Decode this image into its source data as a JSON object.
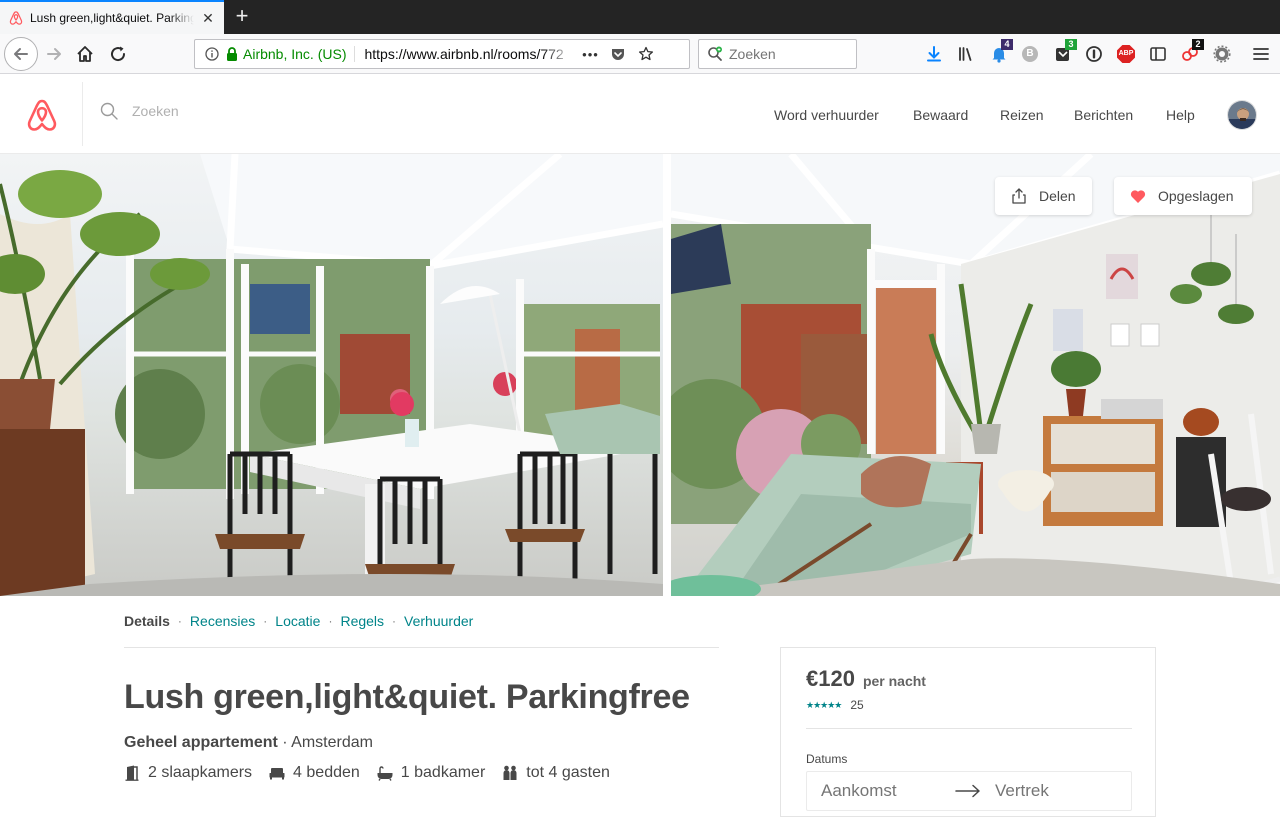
{
  "browser": {
    "tab": {
      "title": "Lush green,light&quiet. Parkingfree"
    },
    "url_identity": "Airbnb, Inc. (US)",
    "url": "https://www.airbnb.nl/rooms/772",
    "search_placeholder": "Zoeken",
    "more_icon": "•••",
    "badges": {
      "notifications": "4",
      "extension_green": "3",
      "extension_dark": "2"
    },
    "abp_label": "ABP",
    "b_label": "B"
  },
  "site": {
    "search_placeholder": "Zoeken",
    "nav": {
      "host": "Word verhuurder",
      "saved": "Bewaard",
      "trips": "Reizen",
      "messages": "Berichten",
      "help": "Help"
    }
  },
  "photos": {
    "share_label": "Delen",
    "saved_label": "Opgeslagen"
  },
  "subnav": {
    "details": "Details",
    "reviews": "Recensies",
    "location": "Locatie",
    "rules": "Regels",
    "host": "Verhuurder",
    "separator": "·"
  },
  "listing": {
    "title": "Lush green,light&quiet. Parkingfree",
    "type": "Geheel appartement",
    "type_separator": "·",
    "city": "Amsterdam",
    "facts": {
      "bedrooms": "2 slaapkamers",
      "beds": "4 bedden",
      "bathrooms": "1 badkamer",
      "guests": "tot 4 gasten"
    }
  },
  "booking": {
    "price": "€120",
    "per_night": "per nacht",
    "stars": "★★★★★",
    "review_count": "25",
    "dates_label": "Datums",
    "checkin_placeholder": "Aankomst",
    "checkout_placeholder": "Vertrek"
  },
  "colors": {
    "brand": "#FF5A5F",
    "teal": "#008489",
    "text": "#484848",
    "secure_green": "#058B00"
  }
}
